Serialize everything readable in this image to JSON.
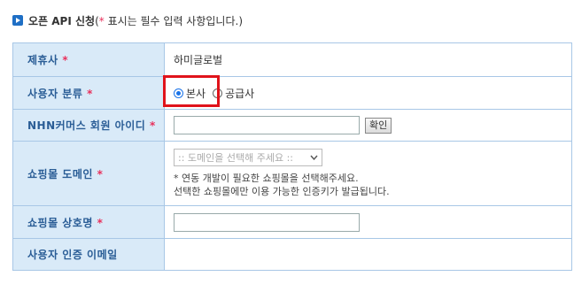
{
  "header": {
    "title": "오픈 API 신청",
    "note_prefix": "(",
    "note_star": "*",
    "note_text": " 표시는 필수 입력 사항입니다.)"
  },
  "required_mark": "*",
  "rows": {
    "partner": {
      "label": "제휴사",
      "value": "하미글로벌"
    },
    "user_type": {
      "label": "사용자 분류",
      "options": [
        {
          "label": "본사",
          "checked": true
        },
        {
          "label": "공급사",
          "checked": false
        }
      ]
    },
    "nhn_id": {
      "label": "NHN커머스 회원 아이디",
      "input_value": "",
      "check_button": "확인"
    },
    "domain": {
      "label": "쇼핑몰 도메인",
      "select_value": ":: 도메인을 선택해 주세요 ::",
      "note_line1": "* 연동 개발이 필요한 쇼핑몰을 선택해주세요.",
      "note_line2": "선택한 쇼핑몰에만 이용 가능한 인증키가 발급됩니다."
    },
    "shop_name": {
      "label": "쇼핑몰 상호명",
      "input_value": ""
    },
    "email": {
      "label": "사용자 인증 이메일"
    }
  },
  "colors": {
    "label_bg": "#d9eaf8",
    "label_text": "#2a5d96",
    "required": "#e8315c",
    "highlight": "#e0131b",
    "radio_accent": "#1a73e8"
  }
}
